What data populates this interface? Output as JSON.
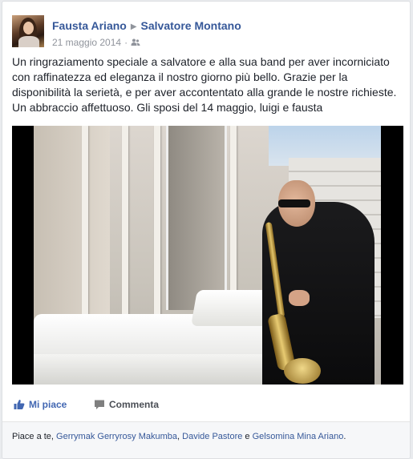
{
  "post": {
    "author": "Fausta Ariano",
    "target": "Salvatore Montano",
    "date": "21 maggio 2014",
    "audience_icon": "friends-icon",
    "text": "Un ringraziamento speciale a salvatore e alla sua band per aver incorniciato con raffinatezza ed eleganza il nostro giorno più bello. Grazie per la disponibilità la serietà, e per aver accontentato alla grande le nostre richieste. Un abbraccio affettuoso. Gli sposi del 14 maggio, luigi e fausta"
  },
  "actions": {
    "like_label": "Mi piace",
    "comment_label": "Commenta",
    "like_icon": "thumbs-up-icon",
    "comment_icon": "comment-icon"
  },
  "likes": {
    "prefix": "Piace a te, ",
    "people": [
      "Gerrymak Gerryrosy Makumba",
      "Davide Pastore",
      "Gelsomina Mina Ariano"
    ],
    "sep1": ", ",
    "sep2": " e ",
    "suffix": "."
  },
  "colors": {
    "link": "#365899",
    "like_active": "#4267b2",
    "page_bg": "#e9ebee"
  }
}
